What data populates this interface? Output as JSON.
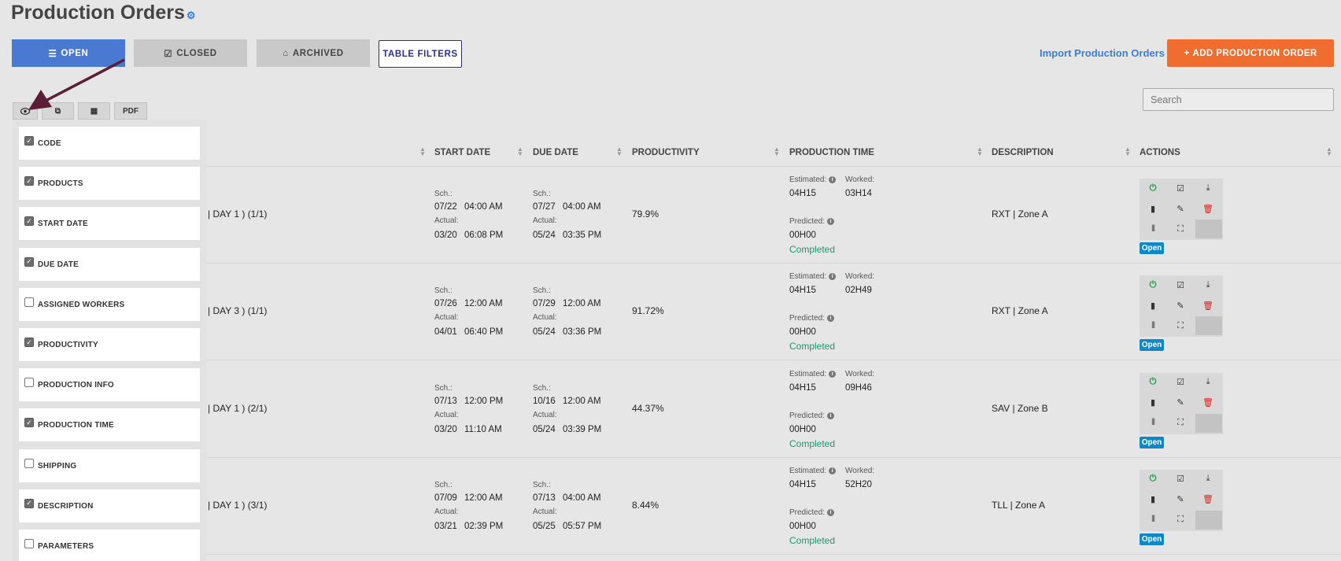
{
  "header": {
    "title": "Production Orders"
  },
  "tabs": {
    "open": "OPEN",
    "closed": "CLOSED",
    "archived": "ARCHIVED",
    "filters": "TABLE FILTERS"
  },
  "import_link": "Import Production Orders",
  "add_button": "ADD PRODUCTION ORDER",
  "search": {
    "placeholder": "Search"
  },
  "toolbar": {
    "pdf": "PDF"
  },
  "columns_panel": [
    {
      "label": "CODE",
      "checked": true
    },
    {
      "label": "PRODUCTS",
      "checked": true
    },
    {
      "label": "START DATE",
      "checked": true
    },
    {
      "label": "DUE DATE",
      "checked": true
    },
    {
      "label": "ASSIGNED WORKERS",
      "checked": false
    },
    {
      "label": "PRODUCTIVITY",
      "checked": true
    },
    {
      "label": "PRODUCTION INFO",
      "checked": false
    },
    {
      "label": "PRODUCTION TIME",
      "checked": true
    },
    {
      "label": "SHIPPING",
      "checked": false
    },
    {
      "label": "DESCRIPTION",
      "checked": true
    },
    {
      "label": "PARAMETERS",
      "checked": false
    }
  ],
  "table": {
    "headers": {
      "start_date": "START DATE",
      "due_date": "DUE DATE",
      "productivity": "PRODUCTIVITY",
      "production_time": "PRODUCTION TIME",
      "description": "DESCRIPTION",
      "actions": "ACTIONS"
    },
    "labels": {
      "sch": "Sch.:",
      "actual": "Actual:",
      "estimated": "Estimated:",
      "worked": "Worked:",
      "predicted": "Predicted:"
    },
    "rows": [
      {
        "product": "| DAY 1 ) (1/1)",
        "start_sch_date": "07/22",
        "start_sch_time": "04:00 AM",
        "start_act_date": "03/20",
        "start_act_time": "06:08 PM",
        "due_sch_date": "07/27",
        "due_sch_time": "04:00 AM",
        "due_act_date": "05/24",
        "due_act_time": "03:35 PM",
        "productivity": "79.9%",
        "estimated": "04H15",
        "worked": "03H14",
        "predicted": "00H00",
        "status": "Completed",
        "description": "RXT | Zone A",
        "badge": "Open"
      },
      {
        "product": "| DAY 3 ) (1/1)",
        "start_sch_date": "07/26",
        "start_sch_time": "12:00 AM",
        "start_act_date": "04/01",
        "start_act_time": "06:40 PM",
        "due_sch_date": "07/29",
        "due_sch_time": "12:00 AM",
        "due_act_date": "05/24",
        "due_act_time": "03:36 PM",
        "productivity": "91.72%",
        "estimated": "04H15",
        "worked": "02H49",
        "predicted": "00H00",
        "status": "Completed",
        "description": "RXT | Zone A",
        "badge": "Open"
      },
      {
        "product": "| DAY 1 ) (2/1)",
        "start_sch_date": "07/13",
        "start_sch_time": "12:00 PM",
        "start_act_date": "03/20",
        "start_act_time": "11:10 AM",
        "due_sch_date": "10/16",
        "due_sch_time": "12:00 AM",
        "due_act_date": "05/24",
        "due_act_time": "03:39 PM",
        "productivity": "44.37%",
        "estimated": "04H15",
        "worked": "09H46",
        "predicted": "00H00",
        "status": "Completed",
        "description": "SAV | Zone B",
        "badge": "Open"
      },
      {
        "product": "| DAY 1 ) (3/1)",
        "start_sch_date": "07/09",
        "start_sch_time": "12:00 AM",
        "start_act_date": "03/21",
        "start_act_time": "02:39 PM",
        "due_sch_date": "07/13",
        "due_sch_time": "04:00 AM",
        "due_act_date": "05/25",
        "due_act_time": "05:57 PM",
        "productivity": "8.44%",
        "estimated": "04H15",
        "worked": "52H20",
        "predicted": "00H00",
        "status": "Completed",
        "description": "TLL | Zone A",
        "badge": "Open"
      }
    ]
  },
  "colors": {
    "primary": "#4a79d1",
    "accent": "#f06d2f",
    "success": "#1a9a6a",
    "badge": "#1088c8",
    "arrow": "#5a1f36"
  }
}
